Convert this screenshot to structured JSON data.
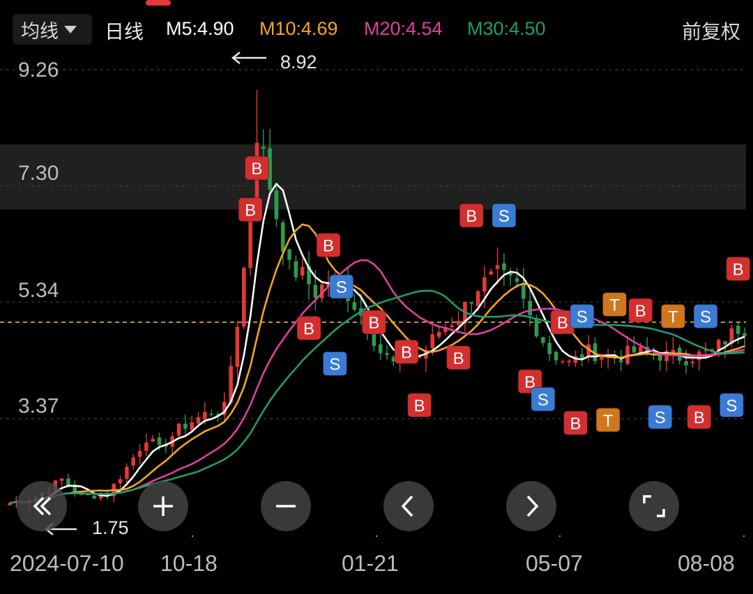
{
  "header": {
    "ma_selector": "均线",
    "period": "日线",
    "ma5": {
      "label": "M5:4.90",
      "color": "#ffffff"
    },
    "ma10": {
      "label": "M10:4.69",
      "color": "#f5a623"
    },
    "ma20": {
      "label": "M20:4.54",
      "color": "#e040a0"
    },
    "ma30": {
      "label": "M30:4.50",
      "color": "#1e9e6a"
    },
    "adjust": "前复权"
  },
  "y_axis": [
    "9.26",
    "7.30",
    "5.34",
    "3.37"
  ],
  "annotations": {
    "high": "8.92",
    "low": "1.75"
  },
  "x_axis": [
    "2024-07-10",
    "10-18",
    "01-21",
    "05-07",
    "08-08"
  ],
  "colors": {
    "up": "#e53935",
    "down": "#2e9c4f",
    "buy": "#d32f2f",
    "sell": "#3a7bd5",
    "t": "#d0761c",
    "current": "#f5c05a"
  },
  "controls": [
    {
      "name": "scroll-left-button",
      "icon": "double-chevron-left-icon"
    },
    {
      "name": "zoom-in-button",
      "icon": "plus-icon"
    },
    {
      "name": "zoom-out-button",
      "icon": "minus-icon"
    },
    {
      "name": "previous-button",
      "icon": "chevron-left-icon"
    },
    {
      "name": "next-button",
      "icon": "chevron-right-icon"
    },
    {
      "name": "fullscreen-button",
      "icon": "fullscreen-icon"
    }
  ],
  "chart_data": {
    "type": "candlestick",
    "adjustment": "前复权",
    "period": "日线",
    "ylim": [
      1.75,
      9.26
    ],
    "high": 8.92,
    "low": 1.75,
    "current_price_line": 5.0,
    "highlight_band": [
      6.9,
      8.0
    ],
    "x_ticks": [
      "2024-07-10",
      "10-18",
      "01-21",
      "05-07",
      "08-08"
    ],
    "ma_values_latest": {
      "MA5": 4.9,
      "MA10": 4.69,
      "MA20": 4.54,
      "MA30": 4.5
    },
    "price_path": [
      [
        0,
        1.95
      ],
      [
        4,
        2.05
      ],
      [
        8,
        2.35
      ],
      [
        11,
        2.05
      ],
      [
        15,
        2.1
      ],
      [
        18,
        2.55
      ],
      [
        21,
        3.05
      ],
      [
        23,
        2.85
      ],
      [
        26,
        3.2
      ],
      [
        30,
        3.45
      ],
      [
        33,
        3.55
      ],
      [
        35,
        5.0
      ],
      [
        37,
        6.8
      ],
      [
        38,
        8.2
      ],
      [
        39,
        7.8
      ],
      [
        41,
        6.8
      ],
      [
        43,
        5.9
      ],
      [
        45,
        5.8
      ],
      [
        47,
        5.5
      ],
      [
        49,
        5.7
      ],
      [
        51,
        5.65
      ],
      [
        53,
        5.3
      ],
      [
        55,
        4.95
      ],
      [
        57,
        4.5
      ],
      [
        59,
        4.3
      ],
      [
        61,
        4.5
      ],
      [
        63,
        4.4
      ],
      [
        66,
        4.85
      ],
      [
        69,
        5.1
      ],
      [
        72,
        5.6
      ],
      [
        75,
        5.8
      ],
      [
        78,
        5.6
      ],
      [
        80,
        5.1
      ],
      [
        83,
        4.5
      ],
      [
        86,
        4.3
      ],
      [
        89,
        4.5
      ],
      [
        93,
        4.4
      ],
      [
        96,
        4.5
      ],
      [
        100,
        4.45
      ],
      [
        104,
        4.4
      ],
      [
        108,
        4.5
      ],
      [
        112,
        4.9
      ]
    ],
    "trade_markers": [
      {
        "type": "B",
        "t": 37,
        "price": 6.9
      },
      {
        "type": "B",
        "t": 38,
        "price": 7.6
      },
      {
        "type": "B",
        "t": 49,
        "price": 6.3
      },
      {
        "type": "B",
        "t": 46,
        "price": 4.9
      },
      {
        "type": "S",
        "t": 51,
        "price": 5.6
      },
      {
        "type": "S",
        "t": 50,
        "price": 4.3
      },
      {
        "type": "B",
        "t": 56,
        "price": 5.0
      },
      {
        "type": "B",
        "t": 61,
        "price": 4.5
      },
      {
        "type": "B",
        "t": 63,
        "price": 3.6
      },
      {
        "type": "B",
        "t": 71,
        "price": 6.8
      },
      {
        "type": "S",
        "t": 76,
        "price": 6.8
      },
      {
        "type": "B",
        "t": 69,
        "price": 4.4
      },
      {
        "type": "B",
        "t": 80,
        "price": 4.0
      },
      {
        "type": "S",
        "t": 82,
        "price": 3.7
      },
      {
        "type": "B",
        "t": 85,
        "price": 5.0
      },
      {
        "type": "S",
        "t": 88,
        "price": 5.1
      },
      {
        "type": "T",
        "t": 93,
        "price": 5.3
      },
      {
        "type": "B",
        "t": 97,
        "price": 5.2
      },
      {
        "type": "T",
        "t": 102,
        "price": 5.1
      },
      {
        "type": "S",
        "t": 107,
        "price": 5.1
      },
      {
        "type": "B",
        "t": 112,
        "price": 5.9
      },
      {
        "type": "B",
        "t": 87,
        "price": 3.3
      },
      {
        "type": "T",
        "t": 92,
        "price": 3.35
      },
      {
        "type": "S",
        "t": 100,
        "price": 3.4
      },
      {
        "type": "B",
        "t": 106,
        "price": 3.4
      },
      {
        "type": "S",
        "t": 111,
        "price": 3.6
      }
    ]
  }
}
